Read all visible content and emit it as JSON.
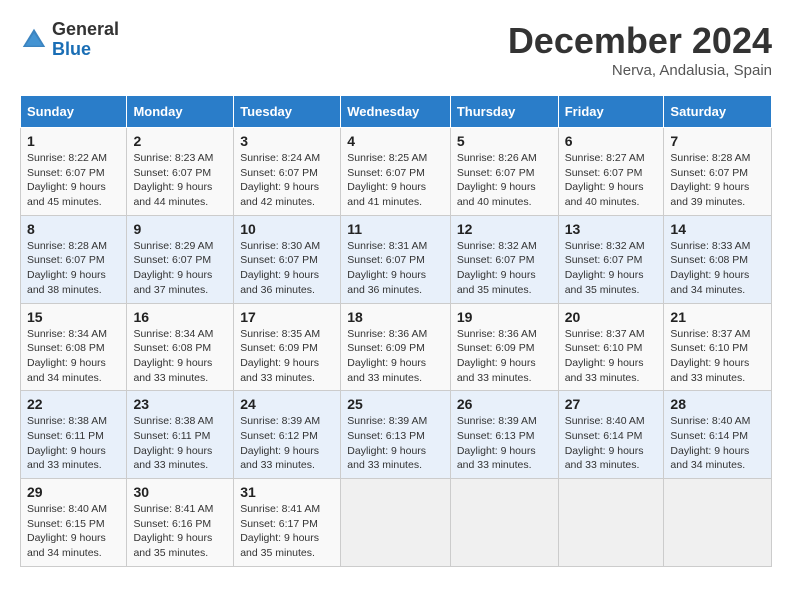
{
  "logo": {
    "line1": "General",
    "line2": "Blue"
  },
  "title": "December 2024",
  "subtitle": "Nerva, Andalusia, Spain",
  "weekdays": [
    "Sunday",
    "Monday",
    "Tuesday",
    "Wednesday",
    "Thursday",
    "Friday",
    "Saturday"
  ],
  "weeks": [
    [
      {
        "day": "1",
        "detail": "Sunrise: 8:22 AM\nSunset: 6:07 PM\nDaylight: 9 hours and 45 minutes."
      },
      {
        "day": "2",
        "detail": "Sunrise: 8:23 AM\nSunset: 6:07 PM\nDaylight: 9 hours and 44 minutes."
      },
      {
        "day": "3",
        "detail": "Sunrise: 8:24 AM\nSunset: 6:07 PM\nDaylight: 9 hours and 42 minutes."
      },
      {
        "day": "4",
        "detail": "Sunrise: 8:25 AM\nSunset: 6:07 PM\nDaylight: 9 hours and 41 minutes."
      },
      {
        "day": "5",
        "detail": "Sunrise: 8:26 AM\nSunset: 6:07 PM\nDaylight: 9 hours and 40 minutes."
      },
      {
        "day": "6",
        "detail": "Sunrise: 8:27 AM\nSunset: 6:07 PM\nDaylight: 9 hours and 40 minutes."
      },
      {
        "day": "7",
        "detail": "Sunrise: 8:28 AM\nSunset: 6:07 PM\nDaylight: 9 hours and 39 minutes."
      }
    ],
    [
      {
        "day": "8",
        "detail": "Sunrise: 8:28 AM\nSunset: 6:07 PM\nDaylight: 9 hours and 38 minutes."
      },
      {
        "day": "9",
        "detail": "Sunrise: 8:29 AM\nSunset: 6:07 PM\nDaylight: 9 hours and 37 minutes."
      },
      {
        "day": "10",
        "detail": "Sunrise: 8:30 AM\nSunset: 6:07 PM\nDaylight: 9 hours and 36 minutes."
      },
      {
        "day": "11",
        "detail": "Sunrise: 8:31 AM\nSunset: 6:07 PM\nDaylight: 9 hours and 36 minutes."
      },
      {
        "day": "12",
        "detail": "Sunrise: 8:32 AM\nSunset: 6:07 PM\nDaylight: 9 hours and 35 minutes."
      },
      {
        "day": "13",
        "detail": "Sunrise: 8:32 AM\nSunset: 6:07 PM\nDaylight: 9 hours and 35 minutes."
      },
      {
        "day": "14",
        "detail": "Sunrise: 8:33 AM\nSunset: 6:08 PM\nDaylight: 9 hours and 34 minutes."
      }
    ],
    [
      {
        "day": "15",
        "detail": "Sunrise: 8:34 AM\nSunset: 6:08 PM\nDaylight: 9 hours and 34 minutes."
      },
      {
        "day": "16",
        "detail": "Sunrise: 8:34 AM\nSunset: 6:08 PM\nDaylight: 9 hours and 33 minutes."
      },
      {
        "day": "17",
        "detail": "Sunrise: 8:35 AM\nSunset: 6:09 PM\nDaylight: 9 hours and 33 minutes."
      },
      {
        "day": "18",
        "detail": "Sunrise: 8:36 AM\nSunset: 6:09 PM\nDaylight: 9 hours and 33 minutes."
      },
      {
        "day": "19",
        "detail": "Sunrise: 8:36 AM\nSunset: 6:09 PM\nDaylight: 9 hours and 33 minutes."
      },
      {
        "day": "20",
        "detail": "Sunrise: 8:37 AM\nSunset: 6:10 PM\nDaylight: 9 hours and 33 minutes."
      },
      {
        "day": "21",
        "detail": "Sunrise: 8:37 AM\nSunset: 6:10 PM\nDaylight: 9 hours and 33 minutes."
      }
    ],
    [
      {
        "day": "22",
        "detail": "Sunrise: 8:38 AM\nSunset: 6:11 PM\nDaylight: 9 hours and 33 minutes."
      },
      {
        "day": "23",
        "detail": "Sunrise: 8:38 AM\nSunset: 6:11 PM\nDaylight: 9 hours and 33 minutes."
      },
      {
        "day": "24",
        "detail": "Sunrise: 8:39 AM\nSunset: 6:12 PM\nDaylight: 9 hours and 33 minutes."
      },
      {
        "day": "25",
        "detail": "Sunrise: 8:39 AM\nSunset: 6:13 PM\nDaylight: 9 hours and 33 minutes."
      },
      {
        "day": "26",
        "detail": "Sunrise: 8:39 AM\nSunset: 6:13 PM\nDaylight: 9 hours and 33 minutes."
      },
      {
        "day": "27",
        "detail": "Sunrise: 8:40 AM\nSunset: 6:14 PM\nDaylight: 9 hours and 33 minutes."
      },
      {
        "day": "28",
        "detail": "Sunrise: 8:40 AM\nSunset: 6:14 PM\nDaylight: 9 hours and 34 minutes."
      }
    ],
    [
      {
        "day": "29",
        "detail": "Sunrise: 8:40 AM\nSunset: 6:15 PM\nDaylight: 9 hours and 34 minutes."
      },
      {
        "day": "30",
        "detail": "Sunrise: 8:41 AM\nSunset: 6:16 PM\nDaylight: 9 hours and 35 minutes."
      },
      {
        "day": "31",
        "detail": "Sunrise: 8:41 AM\nSunset: 6:17 PM\nDaylight: 9 hours and 35 minutes."
      },
      null,
      null,
      null,
      null
    ]
  ]
}
